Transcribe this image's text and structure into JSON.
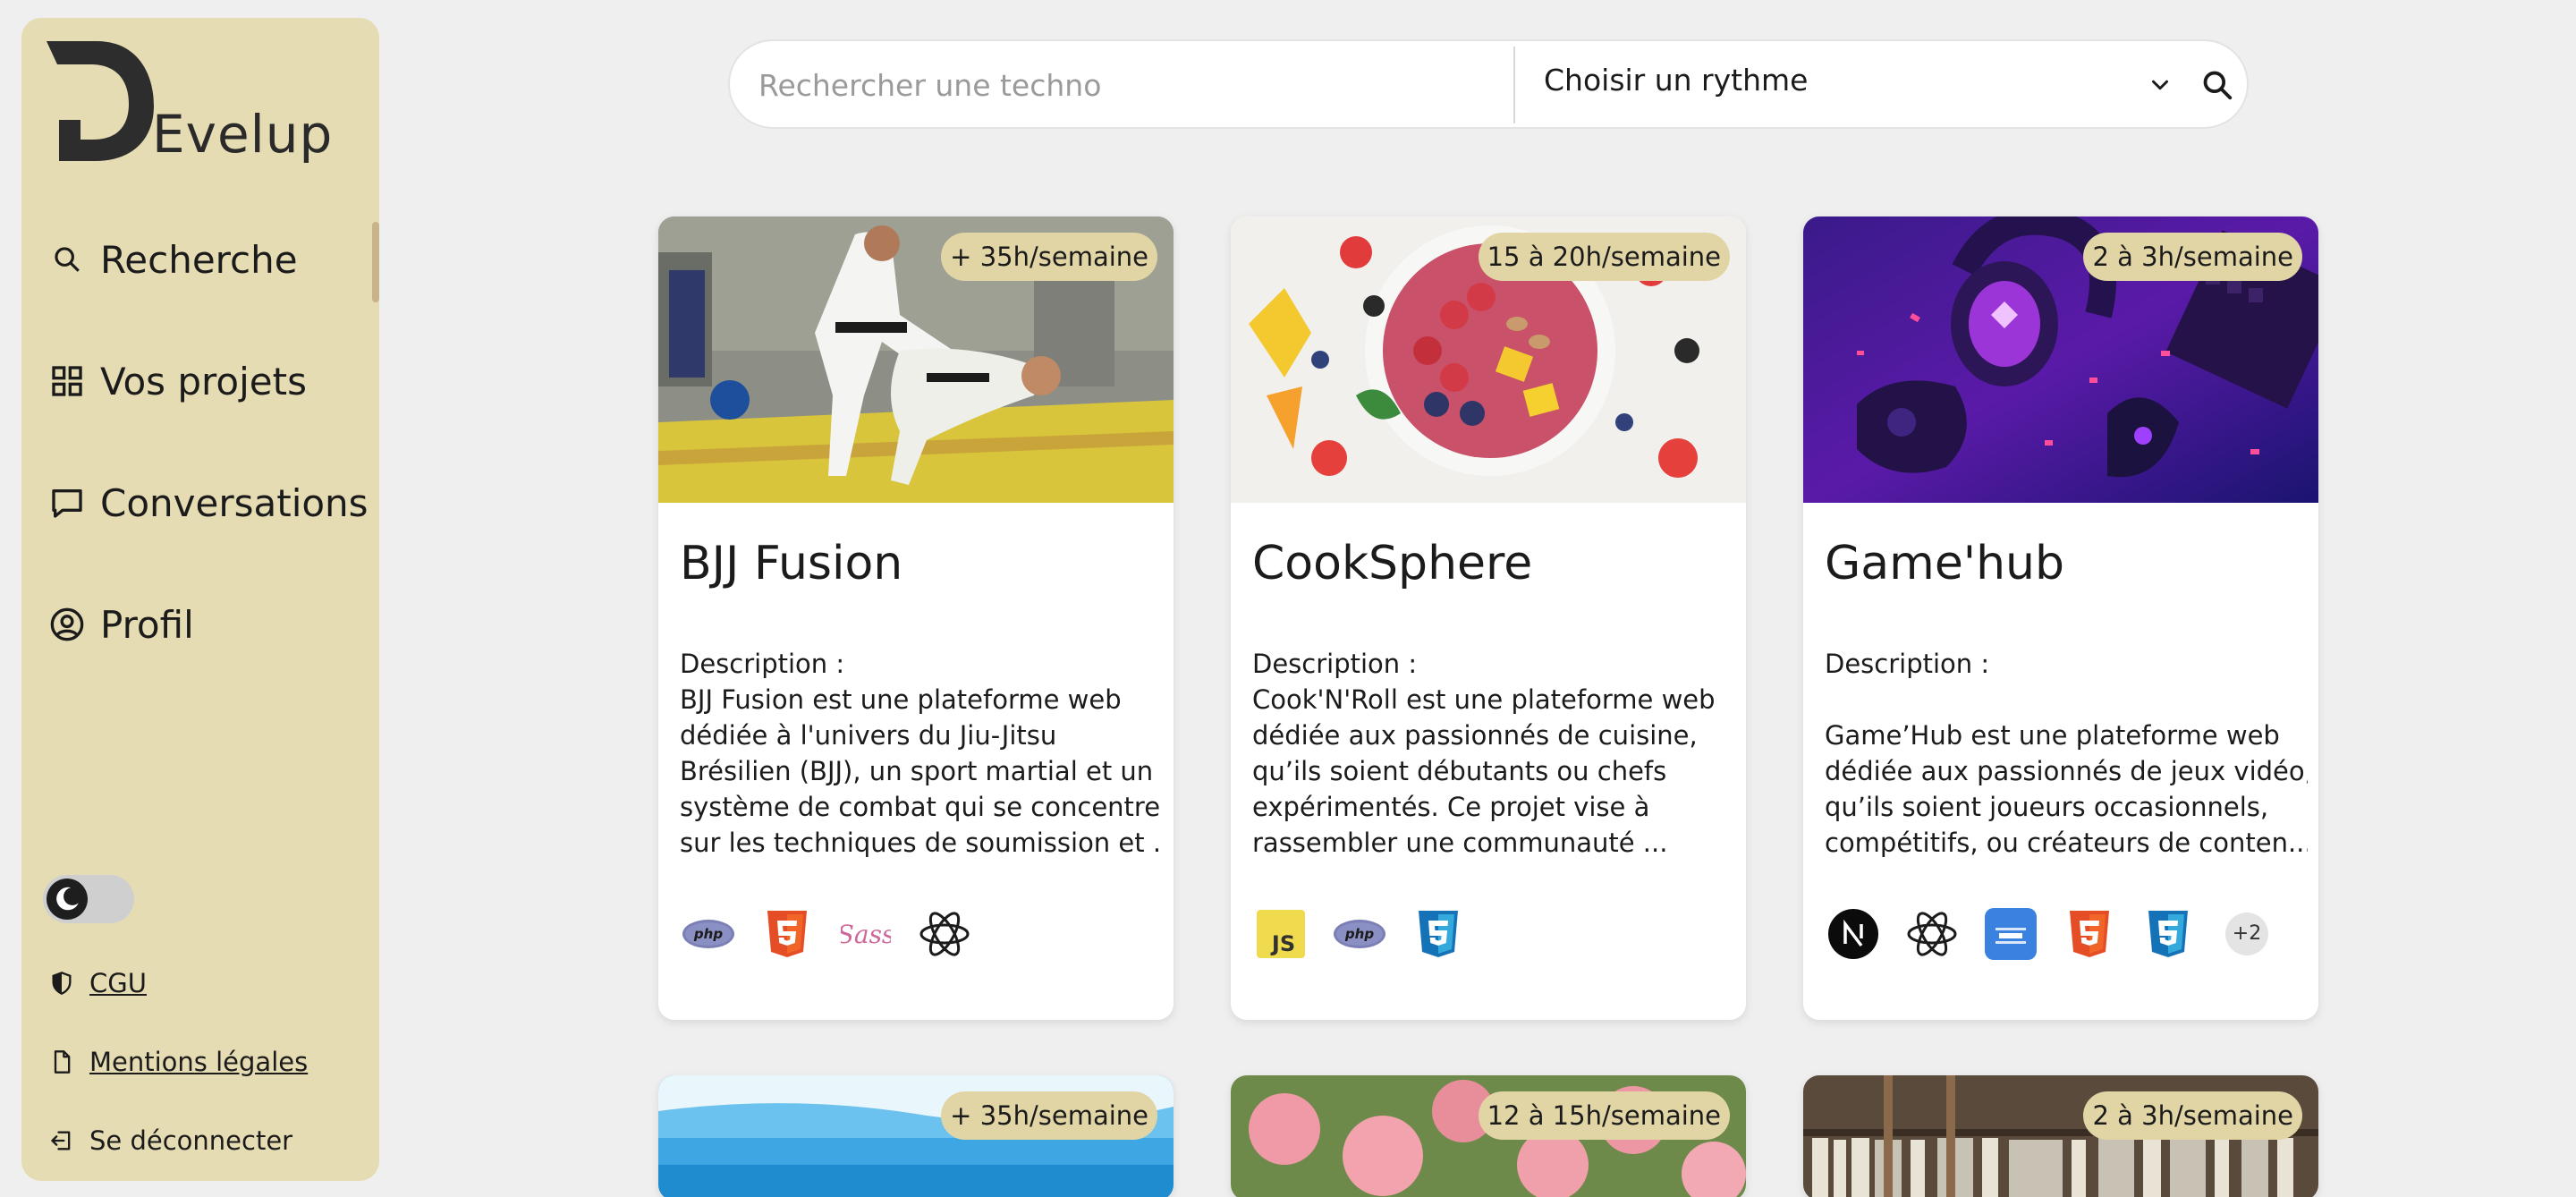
{
  "brand": {
    "logo_letter": "D",
    "logo_text": "Evelup"
  },
  "sidebar": {
    "items": [
      {
        "label": "Recherche",
        "icon": "search-icon"
      },
      {
        "label": "Vos projets",
        "icon": "grid-icon"
      },
      {
        "label": "Conversations",
        "icon": "chat-icon"
      },
      {
        "label": "Profil",
        "icon": "user-circle-icon"
      }
    ],
    "theme_toggle_icon": "moon-icon",
    "footer": {
      "cgu": "CGU",
      "legal": "Mentions légales",
      "logout": "Se déconnecter"
    }
  },
  "search": {
    "placeholder": "Rechercher une techno",
    "value": "",
    "rhythm_label": "Choisir un rythme"
  },
  "colors": {
    "sidebar_bg": "#e6dcb3",
    "badge_bg": "#e2d5a5",
    "page_bg": "#efefef"
  },
  "projects": [
    {
      "title": "BJJ Fusion",
      "rhythm": "+ 35h/semaine",
      "image": "judo-throw-photo",
      "desc_lines": [
        "Description :",
        "BJJ Fusion est une plateforme web",
        "dédiée à l'univers du Jiu-Jitsu",
        "Brésilien (BJJ), un sport martial et un",
        "système de combat qui se concentre",
        "sur les techniques de soumission et ..."
      ],
      "techs": [
        "php-icon",
        "html5-icon",
        "sass-icon",
        "react-icon"
      ]
    },
    {
      "title": "CookSphere",
      "rhythm": "15 à 20h/semaine",
      "image": "fruit-bowl-photo",
      "desc_lines": [
        "Description :",
        "Cook'N'Roll est une plateforme web",
        "dédiée aux passionnés de cuisine,",
        "qu’ils soient débutants ou chefs",
        "expérimentés. Ce projet vise à",
        "rassembler une communauté ..."
      ],
      "techs": [
        "javascript-icon",
        "php-icon",
        "css3-icon"
      ]
    },
    {
      "title": "Game'hub",
      "rhythm": "2 à 3h/semaine",
      "image": "gaming-gear-photo",
      "desc_lines": [
        "Description :",
        "",
        "Game’Hub est une plateforme web",
        "dédiée aux passionnés de jeux vidéo,",
        "qu’ils soient joueurs occasionnels,",
        "compétitifs, ou créateurs de conten..."
      ],
      "techs": [
        "nextjs-icon",
        "react-icon",
        "tailwind-icon",
        "html5-icon",
        "css3-icon"
      ],
      "more": "+2"
    },
    {
      "rhythm": "+ 35h/semaine",
      "image": "beach-photo"
    },
    {
      "rhythm": "12 à 15h/semaine",
      "image": "roses-photo"
    },
    {
      "rhythm": "2 à 3h/semaine",
      "image": "bookshelf-photo"
    }
  ]
}
